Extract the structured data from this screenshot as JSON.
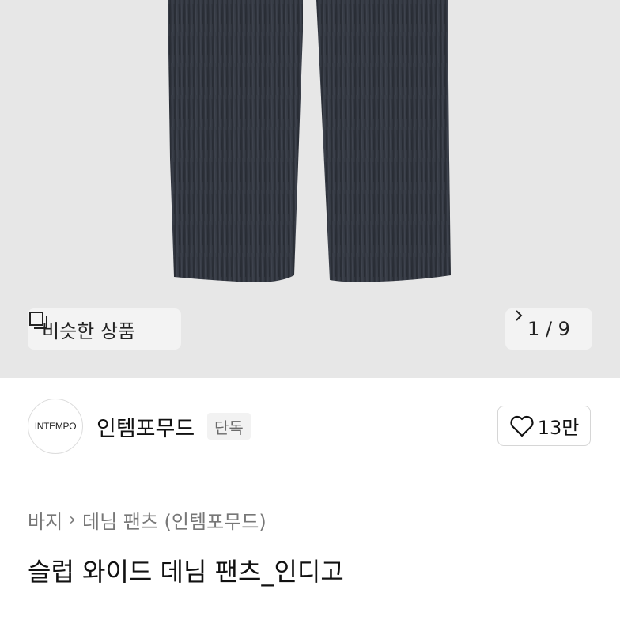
{
  "gallery": {
    "similar_label": "비슷한 상품",
    "counter": "1 / 9"
  },
  "brand": {
    "logo_text": "INTEMPO",
    "name": "인템포무드",
    "badge": "단독"
  },
  "like": {
    "count": "13만"
  },
  "breadcrumb": {
    "category": "바지",
    "subcategory": "데님 팬츠 (인템포무드)"
  },
  "product": {
    "title": "슬럽 와이드 데님 팬츠_인디고"
  },
  "colors": {
    "hero_bg": "#e7e7e7",
    "denim": "#2b2f38"
  }
}
